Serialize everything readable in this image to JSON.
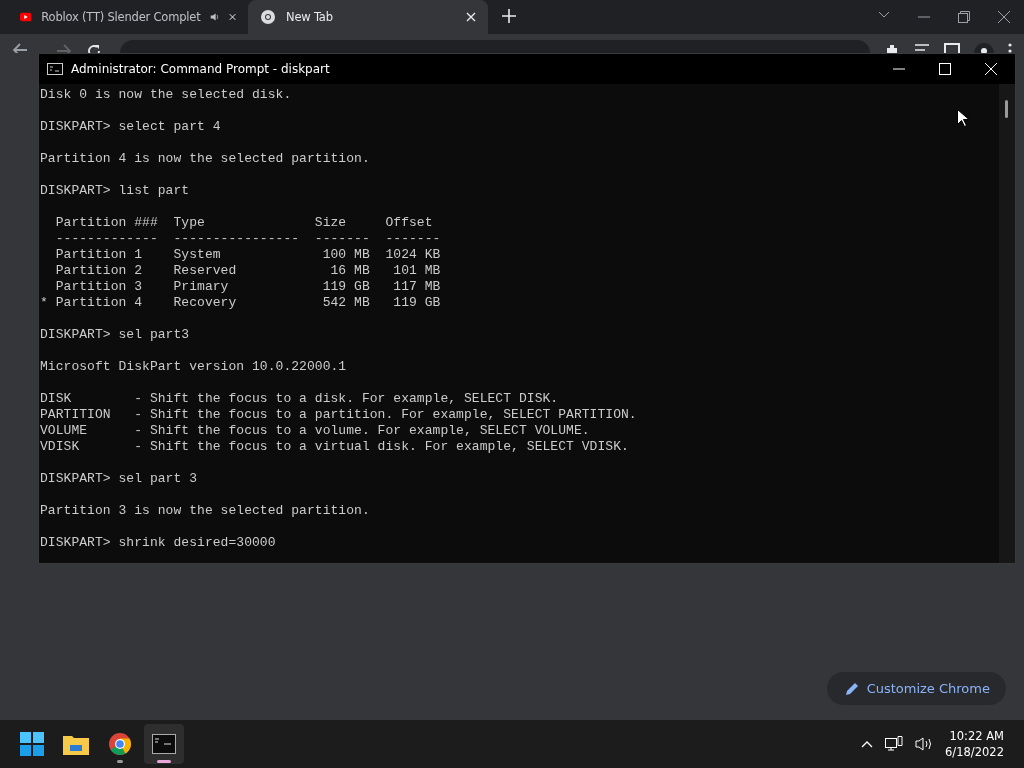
{
  "browser": {
    "tabs": [
      {
        "title": "Roblox (TT) Slender Complet",
        "selected": false,
        "audio": true
      },
      {
        "title": "New Tab",
        "selected": true,
        "audio": false
      }
    ],
    "customize_button": "Customize Chrome"
  },
  "console": {
    "title": "Administrator: Command Prompt - diskpart",
    "blocks": [
      [
        "Disk 0 is now the selected disk."
      ],
      [
        "DISKPART> select part 4"
      ],
      [
        "Partition 4 is now the selected partition."
      ],
      [
        "DISKPART> list part"
      ],
      [
        "  Partition ###  Type              Size     Offset",
        "  -------------  ----------------  -------  -------",
        "  Partition 1    System             100 MB  1024 KB",
        "  Partition 2    Reserved            16 MB   101 MB",
        "  Partition 3    Primary            119 GB   117 MB",
        "* Partition 4    Recovery           542 MB   119 GB"
      ],
      [
        "DISKPART> sel part3"
      ],
      [
        "Microsoft DiskPart version 10.0.22000.1"
      ],
      [
        "DISK        - Shift the focus to a disk. For example, SELECT DISK.",
        "PARTITION   - Shift the focus to a partition. For example, SELECT PARTITION.",
        "VOLUME      - Shift the focus to a volume. For example, SELECT VOLUME.",
        "VDISK       - Shift the focus to a virtual disk. For example, SELECT VDISK."
      ],
      [
        "DISKPART> sel part 3"
      ],
      [
        "Partition 3 is now the selected partition."
      ],
      [
        "DISKPART> shrink desired=30000"
      ]
    ]
  },
  "taskbar": {
    "apps": [
      {
        "kind": "start",
        "running": false,
        "active": false
      },
      {
        "kind": "folder",
        "running": false,
        "active": false
      },
      {
        "kind": "chrome",
        "running": true,
        "active": false
      },
      {
        "kind": "terminal",
        "running": true,
        "active": true
      }
    ],
    "clock": {
      "time": "10:22 AM",
      "date": "6/18/2022"
    }
  }
}
